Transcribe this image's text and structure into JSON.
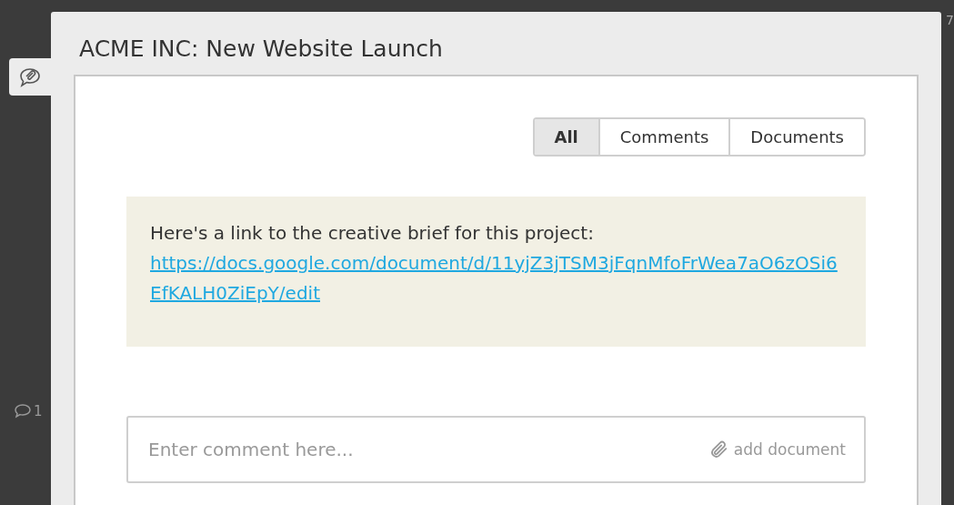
{
  "background": {
    "comment_count": "1",
    "corner_text": "7"
  },
  "modal": {
    "title": "ACME INC: New Website Launch"
  },
  "filter_tabs": [
    {
      "label": "All",
      "selected": true
    },
    {
      "label": "Comments",
      "selected": false
    },
    {
      "label": "Documents",
      "selected": false
    }
  ],
  "messages": [
    {
      "text": "Here's a link to the creative brief for this project:",
      "link": "https://docs.google.com/document/d/11yjZ3jTSM3jFqnMfoFrWea7aO6zOSi6EfKALH0ZiEpY/edit"
    }
  ],
  "comment_input": {
    "placeholder": "Enter comment here...",
    "add_document": "add document"
  }
}
